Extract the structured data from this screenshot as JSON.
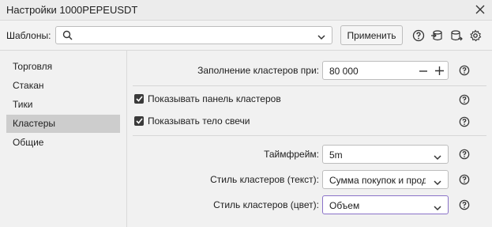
{
  "window": {
    "title": "Настройки 1000PEPEUSDT"
  },
  "templates": {
    "label": "Шаблоны:",
    "value": "",
    "apply_label": "Применить"
  },
  "sidebar": {
    "items": [
      {
        "label": "Торговля"
      },
      {
        "label": "Стакан"
      },
      {
        "label": "Тики"
      },
      {
        "label": "Кластеры",
        "active": true
      },
      {
        "label": "Общие"
      }
    ]
  },
  "settings": {
    "fill": {
      "label": "Заполнение кластеров при:",
      "value": "80 000"
    },
    "show_cluster_panel": {
      "label": "Показывать панель кластеров",
      "checked": true
    },
    "show_candle_body": {
      "label": "Показывать тело свечи",
      "checked": true
    },
    "timeframe": {
      "label": "Таймфрейм:",
      "value": "5m"
    },
    "cluster_style_text": {
      "label": "Стиль кластеров (текст):",
      "value": "Сумма покупок и продаж"
    },
    "cluster_style_color": {
      "label": "Стиль кластеров (цвет):",
      "value": "Объем"
    }
  },
  "colors": {
    "accent_focus": "#8a72c8",
    "active_item": "#cdcdcd"
  }
}
